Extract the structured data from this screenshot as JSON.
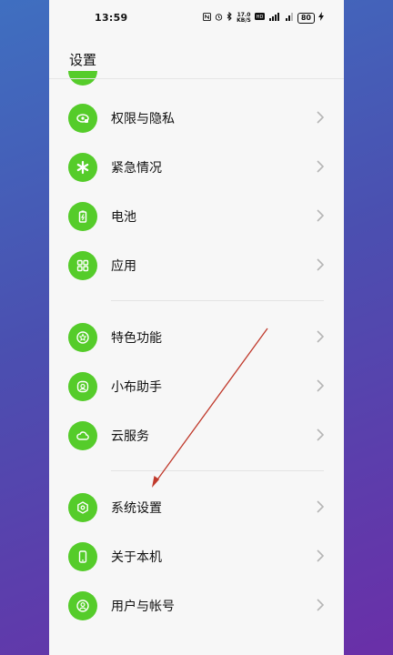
{
  "status": {
    "time": "13:59",
    "net_speed_value": "17.0",
    "net_speed_unit": "KB/S",
    "battery": "80"
  },
  "header": {
    "title": "设置"
  },
  "items": [
    {
      "label": "权限与隐私",
      "icon": "privacy-icon"
    },
    {
      "label": "紧急情况",
      "icon": "emergency-icon"
    },
    {
      "label": "电池",
      "icon": "battery-icon"
    },
    {
      "label": "应用",
      "icon": "apps-grid-icon"
    },
    {
      "label": "特色功能",
      "icon": "star-icon"
    },
    {
      "label": "小布助手",
      "icon": "assistant-icon"
    },
    {
      "label": "云服务",
      "icon": "cloud-icon"
    },
    {
      "label": "系统设置",
      "icon": "gear-hex-icon"
    },
    {
      "label": "关于本机",
      "icon": "phone-icon"
    },
    {
      "label": "用户与帐号",
      "icon": "user-icon"
    }
  ],
  "colors": {
    "icon_bg": "#55cc2a",
    "annotation_arrow": "#c0392b"
  }
}
